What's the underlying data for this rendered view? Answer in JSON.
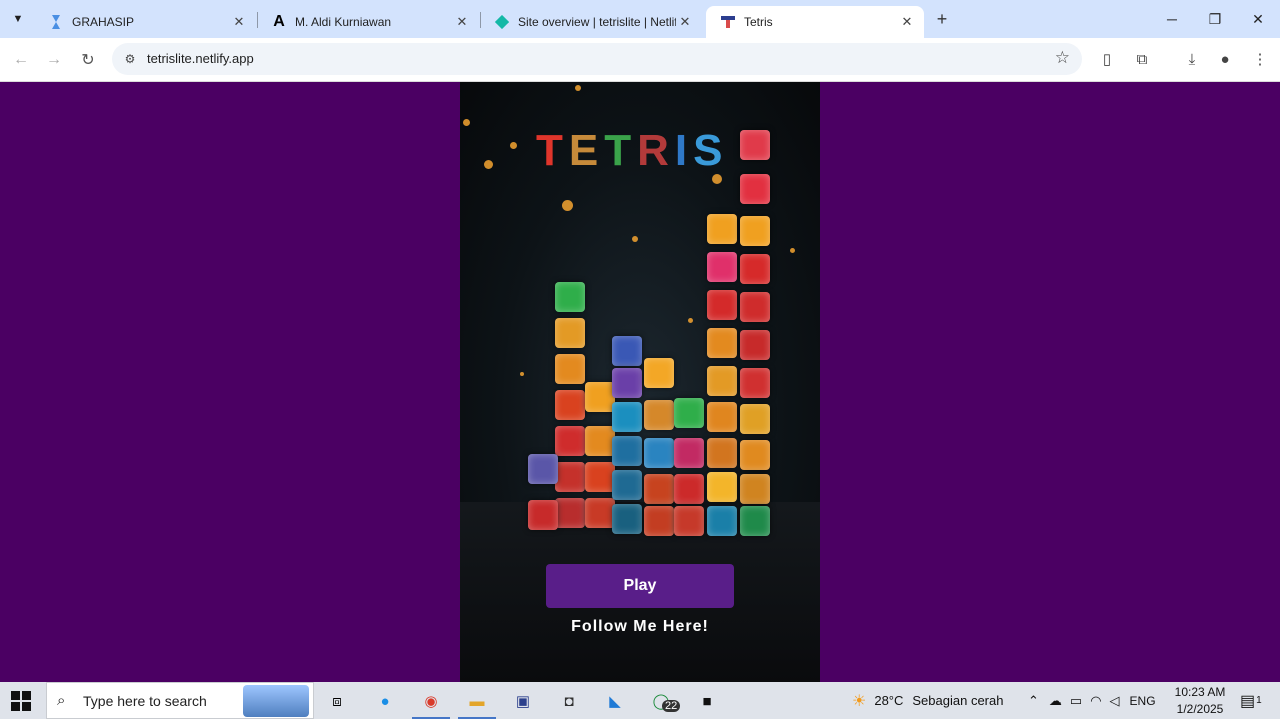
{
  "browser": {
    "tabs": [
      {
        "title": "GRAHASIP",
        "favicon": "grahasip-icon",
        "active": false
      },
      {
        "title": "M. Aldi Kurniawan",
        "favicon": "letter-a-icon",
        "active": false
      },
      {
        "title": "Site overview | tetrislite | Netlify",
        "favicon": "netlify-icon",
        "active": false
      },
      {
        "title": "Tetris",
        "favicon": "tetris-icon",
        "active": true
      }
    ],
    "url": "tetrislite.netlify.app"
  },
  "page": {
    "background_color": "#4b0063",
    "logo_letters": [
      {
        "ch": "T",
        "color": "#e0352b"
      },
      {
        "ch": "E",
        "color": "#c68a3a"
      },
      {
        "ch": "T",
        "color": "#3aa34a"
      },
      {
        "ch": "R",
        "color": "#b23a3a"
      },
      {
        "ch": "I",
        "color": "#2f79c8"
      },
      {
        "ch": "S",
        "color": "#3a9ad9"
      }
    ],
    "play_button": "Play",
    "follow_text": "Follow Me Here!"
  },
  "taskbar": {
    "search_placeholder": "Type here to search",
    "whatsapp_badge": "22",
    "weather_temp": "28°C",
    "weather_desc": "Sebagian cerah",
    "language": "ENG",
    "time": "10:23 AM",
    "date": "1/2/2025",
    "notification_badge": "1"
  }
}
